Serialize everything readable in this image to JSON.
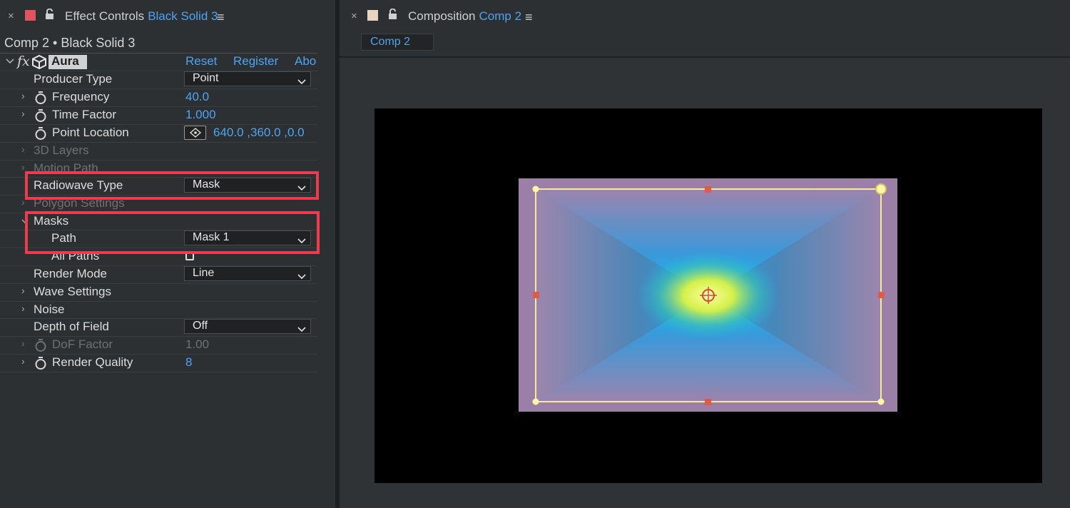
{
  "effect_controls": {
    "tab": {
      "close_glyph": "×",
      "swatch_color": "#e0545e",
      "title": "Effect Controls",
      "layer": "Black Solid 3",
      "menu_glyph": "≡"
    },
    "layer_path": "Comp 2 • Black Solid 3",
    "effect": {
      "fx_glyph": "fx",
      "name": "Aura",
      "reset": "Reset",
      "register": "Register",
      "about": "Abo"
    },
    "properties": {
      "producer_type": {
        "label": "Producer Type",
        "value": "Point"
      },
      "frequency": {
        "label": "Frequency",
        "value": "40.0"
      },
      "time_factor": {
        "label": "Time Factor",
        "value": "1.000"
      },
      "point_location": {
        "label": "Point Location",
        "value": "640.0 ,360.0 ,0.0"
      },
      "layers_3d": {
        "label": "3D Layers"
      },
      "motion_path": {
        "label": "Motion Path"
      },
      "radiowave_type": {
        "label": "Radiowave Type",
        "value": "Mask"
      },
      "polygon_settings": {
        "label": "Polygon Settings"
      },
      "masks": {
        "label": "Masks"
      },
      "path": {
        "label": "Path",
        "value": "Mask 1"
      },
      "all_paths": {
        "label": "All Paths",
        "checked": false
      },
      "render_mode": {
        "label": "Render Mode",
        "value": "Line"
      },
      "wave_settings": {
        "label": "Wave Settings"
      },
      "noise": {
        "label": "Noise"
      },
      "depth_of_field": {
        "label": "Depth of Field",
        "value": "Off"
      },
      "dof_factor": {
        "label": "DoF Factor",
        "value": "1.00"
      },
      "render_quality": {
        "label": "Render Quality",
        "value": "8"
      }
    },
    "highlight_color": "#ee3b4f"
  },
  "composition": {
    "tab": {
      "close_glyph": "×",
      "swatch_color": "#e8d4bf",
      "title": "Composition",
      "name": "Comp 2",
      "menu_glyph": "≡"
    },
    "subtab": "Comp 2",
    "mask_color": "#f5eb9a",
    "handle_color": "#e05a4a"
  }
}
